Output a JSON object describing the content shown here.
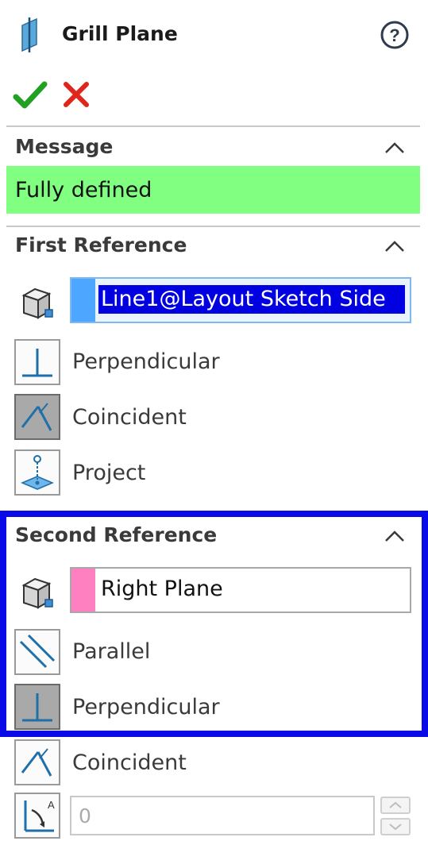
{
  "header": {
    "title": "Grill Plane",
    "title_icon": "plane-icon",
    "help_icon": "help-icon"
  },
  "actions": {
    "ok_icon": "checkmark-icon",
    "cancel_icon": "close-icon"
  },
  "message_section": {
    "title": "Message",
    "text": "Fully defined",
    "background": "#80ff80"
  },
  "first_reference": {
    "title": "First Reference",
    "selection": "Line1@Layout Sketch Side",
    "selection_color": "#4da6ff",
    "options": [
      {
        "label": "Perpendicular",
        "icon": "perpendicular-icon",
        "pressed": false
      },
      {
        "label": "Coincident",
        "icon": "coincident-icon",
        "pressed": true
      },
      {
        "label": "Project",
        "icon": "project-icon",
        "pressed": false
      }
    ]
  },
  "second_reference": {
    "title": "Second Reference",
    "selection": "Right Plane",
    "selection_color": "#ff80c0",
    "options": [
      {
        "label": "Parallel",
        "icon": "parallel-icon",
        "pressed": false
      },
      {
        "label": "Perpendicular",
        "icon": "perpendicular-icon",
        "pressed": true
      },
      {
        "label": "Coincident",
        "icon": "coincident-icon",
        "pressed": false
      }
    ],
    "angle_value": "0",
    "angle_icon": "angle-icon"
  },
  "colors": {
    "highlight_frame": "#0a0ae8",
    "selection_highlight": "#0000e0"
  }
}
